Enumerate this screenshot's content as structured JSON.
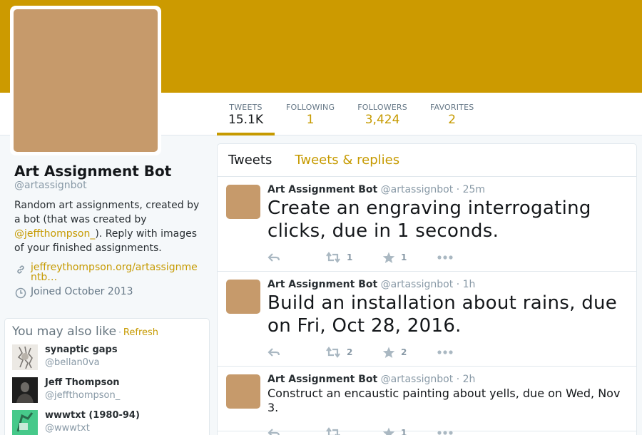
{
  "profile": {
    "name": "Art Assignment Bot",
    "handle": "@artassignbot",
    "bio_before": "Random art assignments, created by a bot (that was created by ",
    "bio_mention": "@jeffthompson_",
    "bio_after": "). Reply with images of your finished assignments.",
    "link_line1": "jeffreythompson.org/artassignme",
    "link_line2": "ntb…",
    "joined": "Joined October 2013"
  },
  "stats": [
    {
      "label": "TWEETS",
      "value": "15.1K"
    },
    {
      "label": "FOLLOWING",
      "value": "1"
    },
    {
      "label": "FOLLOWERS",
      "value": "3,424"
    },
    {
      "label": "FAVORITES",
      "value": "2"
    }
  ],
  "tabs": {
    "tweets": "Tweets",
    "replies": "Tweets & replies"
  },
  "tweets": [
    {
      "name": "Art Assignment Bot",
      "handle": "@artassignbot",
      "sep": " · ",
      "time": "25m",
      "text": "Create an engraving interrogating clicks, due in 1 seconds.",
      "retweets": "1",
      "favorites": "1"
    },
    {
      "name": "Art Assignment Bot",
      "handle": "@artassignbot",
      "sep": " · ",
      "time": "1h",
      "text": "Build an installation about rains, due on Fri, Oct 28, 2016.",
      "retweets": "2",
      "favorites": "2"
    },
    {
      "name": "Art Assignment Bot",
      "handle": "@artassignbot",
      "sep": " · ",
      "time": "2h",
      "text": "Construct an encaustic painting about yells, due on Wed, Nov 3.",
      "retweets": "",
      "favorites": "1"
    }
  ],
  "suggestions": {
    "title": "You may also like",
    "dot": "·",
    "refresh": "Refresh",
    "users": [
      {
        "name": "synaptic gaps",
        "handle": "@bellan0va"
      },
      {
        "name": "Jeff Thompson",
        "handle": "@jeffthompson_"
      },
      {
        "name": "wwwtxt (1980-94)",
        "handle": "@wwwtxt"
      }
    ]
  },
  "icons": {
    "link": "link-icon",
    "calendar": "clock-icon",
    "reply": "reply-icon",
    "retweet": "retweet-icon",
    "favorite": "star-icon",
    "more": "more-icon"
  },
  "colors": {
    "banner": "#cc9a00",
    "accent": "#c69a00",
    "avatar": "#c69a6b"
  }
}
